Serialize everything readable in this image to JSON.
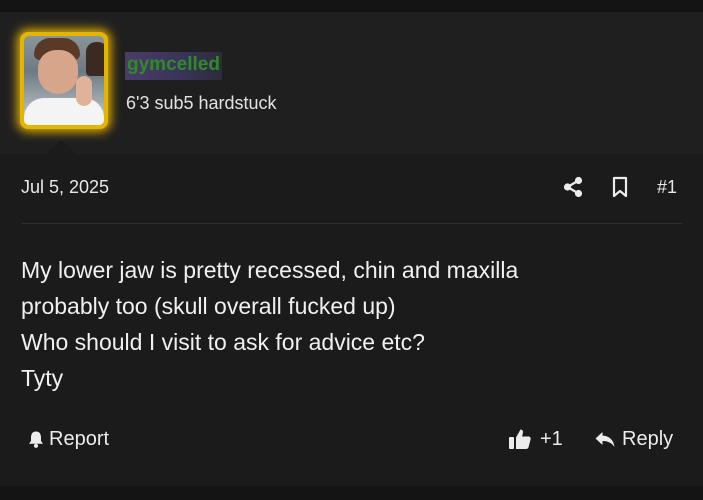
{
  "author": {
    "username": "gymcelled",
    "user_title": "6'3 sub5 hardstuck",
    "avatar": "avatar-photo",
    "avatar_glow_color": "#ffc400",
    "username_color": "#2f8a2a"
  },
  "post": {
    "date": "Jul 5, 2025",
    "number": "#1",
    "body_lines": [
      "My lower jaw is pretty recessed, chin and maxilla",
      "probably too (skull overall fucked up)",
      "Who should I visit to ask for advice etc?",
      "Tyty"
    ]
  },
  "actions": {
    "share_icon": "share-icon",
    "bookmark_icon": "bookmark-icon",
    "report_label": "Report",
    "report_icon": "bell-icon",
    "like_label": "+1",
    "like_icon": "thumbs-up-icon",
    "reply_label": "Reply",
    "reply_icon": "reply-arrow-icon"
  },
  "colors": {
    "background": "#1b1b1b",
    "panel": "#1f1f1f",
    "text": "#ececec"
  }
}
